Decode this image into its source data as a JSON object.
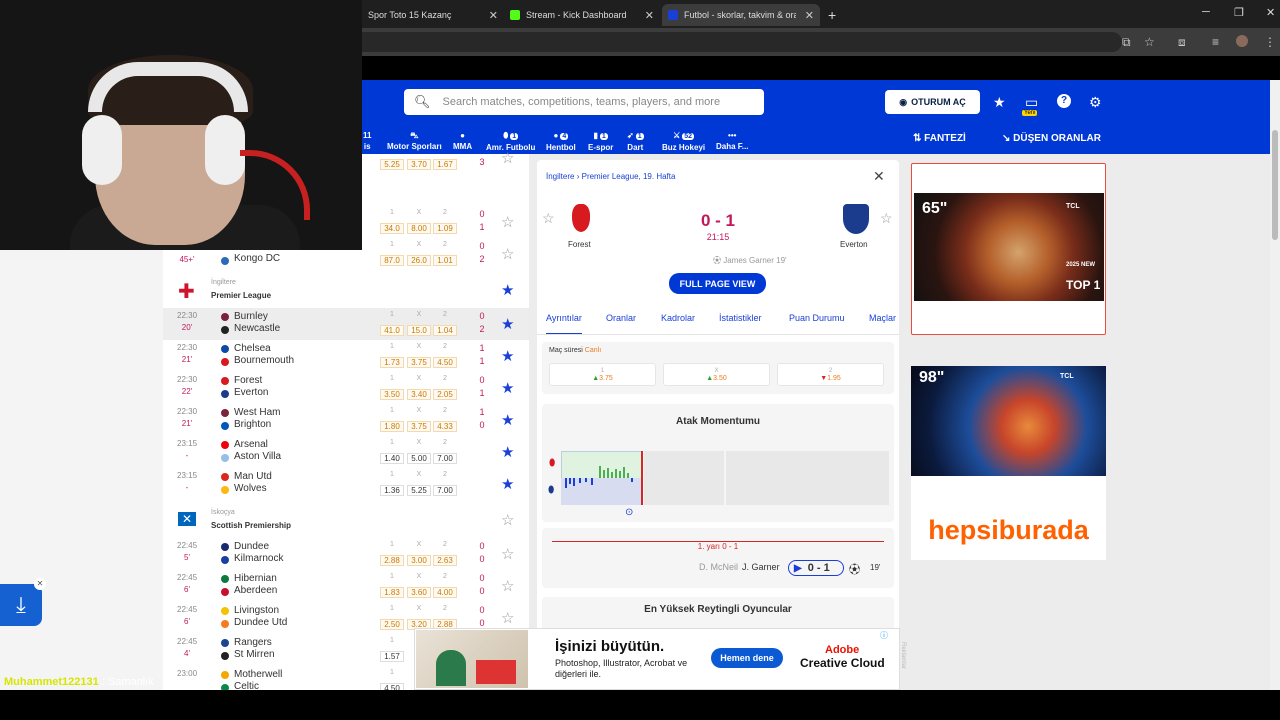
{
  "browser": {
    "tabs": [
      {
        "title": "Spor Toto 15 Kazanç"
      },
      {
        "title": "Stream - Kick Dashboard"
      },
      {
        "title": "Futbol - skorlar, takvim & oranl"
      }
    ],
    "new_tab": "+"
  },
  "header": {
    "search_placeholder": "Search matches, competitions, teams, players, and more",
    "login_label": "OTURUM AÇ",
    "badge_new": "Yeni",
    "fantasy_label": "FANTEZİ",
    "dropping_odds_label": "DÜŞEN ORANLAR"
  },
  "sports_nav": [
    {
      "label": "is",
      "count": ""
    },
    {
      "label": "Motor Sporları",
      "count": ""
    },
    {
      "label": "MMA",
      "count": ""
    },
    {
      "label": "Amr. Futbolu",
      "count": "1"
    },
    {
      "label": "Hentbol",
      "count": "4"
    },
    {
      "label": "E-spor",
      "count": "1"
    },
    {
      "label": "Dart",
      "count": "1"
    },
    {
      "label": "Buz Hokeyi",
      "count": "52"
    },
    {
      "label": "Daha F...",
      "count": ""
    }
  ],
  "nav_first_count": "11",
  "matches_top": [
    {
      "o1": "5.25",
      "ox": "3.70",
      "o2": "1.67",
      "s1": "3",
      "s2": ""
    },
    {
      "o1": "34.0",
      "ox": "8.00",
      "o2": "1.09",
      "s1": "0",
      "s2": "1"
    },
    {
      "min": "45+'",
      "home": "",
      "away": "Kongo DC",
      "o1": "87.0",
      "ox": "26.0",
      "o2": "1.01",
      "s1": "0",
      "s2": "2"
    }
  ],
  "odds_headers": [
    "1",
    "X",
    "2"
  ],
  "league_england": {
    "country": "İngiltere",
    "name": "Premier League"
  },
  "league_scotland": {
    "country": "İskoçya",
    "name": "Scottish Premiership"
  },
  "premier_matches": [
    {
      "time": "22:30",
      "min": "20'",
      "home": "Burnley",
      "away": "Newcastle",
      "o1": "41.0",
      "ox": "15.0",
      "o2": "1.04",
      "s1": "0",
      "s2": "2",
      "hc": "#7a1f3d",
      "ac": "#222"
    },
    {
      "time": "22:30",
      "min": "21'",
      "home": "Chelsea",
      "away": "Bournemouth",
      "o1": "1.73",
      "ox": "3.75",
      "o2": "4.50",
      "s1": "1",
      "s2": "1",
      "hc": "#0b4aa8",
      "ac": "#d71920"
    },
    {
      "time": "22:30",
      "min": "22'",
      "home": "Forest",
      "away": "Everton",
      "o1": "3.50",
      "ox": "3.40",
      "o2": "2.05",
      "s1": "0",
      "s2": "1",
      "hc": "#d71920",
      "ac": "#1b3c8c"
    },
    {
      "time": "22:30",
      "min": "21'",
      "home": "West Ham",
      "away": "Brighton",
      "o1": "1.80",
      "ox": "3.75",
      "o2": "4.33",
      "s1": "1",
      "s2": "0",
      "hc": "#7a263a",
      "ac": "#0057b8"
    },
    {
      "time": "23:15",
      "min": "-",
      "home": "Arsenal",
      "away": "Aston Villa",
      "o1": "1.40",
      "ox": "5.00",
      "o2": "7.00",
      "s1": "",
      "s2": "",
      "hc": "#ef0107",
      "ac": "#95bfe5"
    },
    {
      "time": "23:15",
      "min": "-",
      "home": "Man Utd",
      "away": "Wolves",
      "o1": "1.36",
      "ox": "5.25",
      "o2": "7.00",
      "s1": "",
      "s2": "",
      "hc": "#da291c",
      "ac": "#fdb913"
    }
  ],
  "scottish_matches": [
    {
      "time": "22:45",
      "min": "5'",
      "home": "Dundee",
      "away": "Kilmarnock",
      "o1": "2.88",
      "ox": "3.00",
      "o2": "2.63",
      "s1": "0",
      "s2": "0",
      "hc": "#1a2a6c",
      "ac": "#1a3fa0"
    },
    {
      "time": "22:45",
      "min": "6'",
      "home": "Hibernian",
      "away": "Aberdeen",
      "o1": "1.83",
      "ox": "3.60",
      "o2": "4.00",
      "s1": "0",
      "s2": "0",
      "hc": "#0a7a3e",
      "ac": "#c8102e"
    },
    {
      "time": "22:45",
      "min": "6'",
      "home": "Livingston",
      "away": "Dundee Utd",
      "o1": "2.50",
      "ox": "3.20",
      "o2": "2.88",
      "s1": "0",
      "s2": "0",
      "hc": "#f2c400",
      "ac": "#f47b20"
    },
    {
      "time": "22:45",
      "min": "4'",
      "home": "Rangers",
      "away": "St Mirren",
      "o1": "1.57",
      "ox": "",
      "o2": "",
      "s1": "",
      "s2": "",
      "hc": "#1b458f",
      "ac": "#222"
    },
    {
      "time": "23:00",
      "min": "",
      "home": "Motherwell",
      "away": "Celtic",
      "o1": "4.50",
      "ox": "",
      "o2": "",
      "s1": "",
      "s2": "",
      "hc": "#f2a900",
      "ac": "#0a8a4a"
    }
  ],
  "detail": {
    "breadcrumb_country": "İngiltere",
    "breadcrumb_sep": "›",
    "breadcrumb_league": "Premier League, 19. Hafta",
    "home": "Forest",
    "away": "Everton",
    "score": "0 - 1",
    "clock": "21:15",
    "scorer": "James Garner 19'",
    "full_page": "FULL PAGE VIEW",
    "tabs": [
      "Ayrıntılar",
      "Oranlar",
      "Kadrolar",
      "İstatistikler",
      "Puan Durumu",
      "Maçlar"
    ],
    "duration_label": "Maç süresi",
    "duration_value": "Canlı",
    "odds": [
      {
        "label": "1",
        "value": "3.75",
        "dir": "▲"
      },
      {
        "label": "X",
        "value": "3.50",
        "dir": "▲"
      },
      {
        "label": "2",
        "value": "1.95",
        "dir": "▼"
      }
    ],
    "momentum_title": "Atak Momentumu",
    "half_label": "1. yarı 0 - 1",
    "assist": "D. McNeil",
    "goal_scorer": "J. Garner",
    "event_score": "0 - 1",
    "event_min": "19'",
    "top_players_title": "En Yüksek Reytingli Oyuncular"
  },
  "ads": {
    "tv1_size": "65\"",
    "tv1_badge": "TOP 1",
    "tv1_new": "2025 NEW",
    "tv2_size": "98\"",
    "brand": "TCL",
    "hepsiburada": "hepsiburada",
    "adobe_headline": "İşinizi büyütün.",
    "adobe_sub": "Photoshop, Illustrator, Acrobat ve diğerleri ile.",
    "adobe_cta": "Hemen dene",
    "adobe_brand_1": "Adobe",
    "adobe_brand_2": "Creative Cloud",
    "side_label": "Reklamlar"
  },
  "chat": {
    "user": "Muhammet122131",
    "message": ": Samanlık"
  }
}
